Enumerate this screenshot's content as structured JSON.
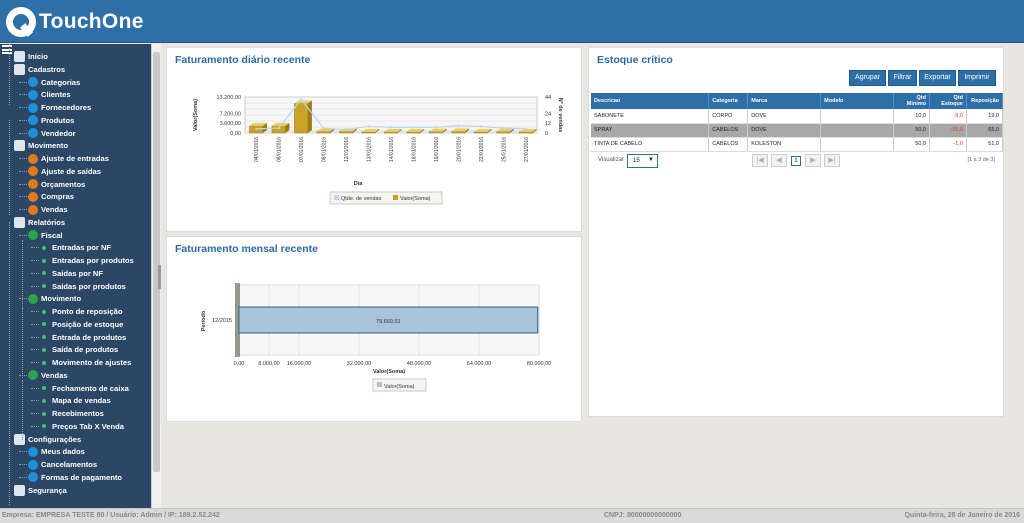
{
  "app": {
    "name": "TouchOne"
  },
  "sidebar": {
    "items": [
      {
        "label": "Início",
        "level": 0,
        "icon": "home-icon"
      },
      {
        "label": "Cadastros",
        "level": 0,
        "icon": "users-icon"
      },
      {
        "label": "Categorias",
        "level": 1,
        "icon": "blue-bullet-icon"
      },
      {
        "label": "Clientes",
        "level": 1,
        "icon": "blue-bullet-icon"
      },
      {
        "label": "Fornecedores",
        "level": 1,
        "icon": "blue-bullet-icon"
      },
      {
        "label": "Produtos",
        "level": 1,
        "icon": "blue-bullet-icon"
      },
      {
        "label": "Vendedor",
        "level": 1,
        "icon": "blue-bullet-icon"
      },
      {
        "label": "Movimento",
        "level": 0,
        "icon": "transfer-icon"
      },
      {
        "label": "Ajuste de entradas",
        "level": 1,
        "icon": "orange-bullet-icon"
      },
      {
        "label": "Ajuste de saídas",
        "level": 1,
        "icon": "orange-bullet-icon"
      },
      {
        "label": "Orçamentos",
        "level": 1,
        "icon": "orange-bullet-icon"
      },
      {
        "label": "Compras",
        "level": 1,
        "icon": "orange-bullet-icon"
      },
      {
        "label": "Vendas",
        "level": 1,
        "icon": "orange-bullet-icon"
      },
      {
        "label": "Relatórios",
        "level": 0,
        "icon": "report-chart-icon"
      },
      {
        "label": "Fiscal",
        "level": 1,
        "icon": "green-bullet-icon"
      },
      {
        "label": "Entradas por NF",
        "level": 2,
        "icon": "green-dot-icon"
      },
      {
        "label": "Entradas por produtos",
        "level": 2,
        "icon": "green-dot-icon"
      },
      {
        "label": "Saídas por NF",
        "level": 2,
        "icon": "green-dot-icon"
      },
      {
        "label": "Saídas por produtos",
        "level": 2,
        "icon": "green-dot-icon"
      },
      {
        "label": "Movimento",
        "level": 1,
        "icon": "green-bullet-icon"
      },
      {
        "label": "Ponto de reposição",
        "level": 2,
        "icon": "green-dot-icon"
      },
      {
        "label": "Posição de estoque",
        "level": 2,
        "icon": "green-dot-icon"
      },
      {
        "label": "Entrada de produtos",
        "level": 2,
        "icon": "green-dot-icon"
      },
      {
        "label": "Saída de produtos",
        "level": 2,
        "icon": "green-dot-icon"
      },
      {
        "label": "Movimento de ajustes",
        "level": 2,
        "icon": "green-dot-icon"
      },
      {
        "label": "Vendas",
        "level": 1,
        "icon": "green-bullet-icon"
      },
      {
        "label": "Fechamento de caixa",
        "level": 2,
        "icon": "green-dot-icon"
      },
      {
        "label": "Mapa de vendas",
        "level": 2,
        "icon": "green-dot-icon"
      },
      {
        "label": "Recebimentos",
        "level": 2,
        "icon": "green-dot-icon"
      },
      {
        "label": "Preços Tab X Venda",
        "level": 2,
        "icon": "green-dot-icon"
      },
      {
        "label": "Configurações",
        "level": 0,
        "icon": "tools-icon"
      },
      {
        "label": "Meus dados",
        "level": 1,
        "icon": "blue-bullet-icon"
      },
      {
        "label": "Cancelamentos",
        "level": 1,
        "icon": "blue-bullet-icon"
      },
      {
        "label": "Formas de pagamento",
        "level": 1,
        "icon": "blue-bullet-icon"
      },
      {
        "label": "Segurança",
        "level": 0,
        "icon": "security-icon"
      }
    ]
  },
  "daily": {
    "title": "Faturamento diário recente",
    "legend": [
      "Qtde. de vendas",
      "Valor(Soma)"
    ]
  },
  "monthly": {
    "title": "Faturamento mensal recente",
    "legend": [
      "Valor(Soma)"
    ]
  },
  "stock": {
    "title": "Estoque crítico",
    "buttons": [
      "Agrupar",
      "Filtrar",
      "Exportar",
      "Imprimir"
    ],
    "columns": [
      "Descricao",
      "Categoria",
      "Marca",
      "Modelo",
      "Qtd Minimo",
      "Qtd Estoque",
      "Reposição"
    ],
    "rows": [
      [
        "SABONETE",
        "CORPO",
        "DOVE",
        "",
        "10,0",
        "-9,0",
        "19,0"
      ],
      [
        "SPRAY",
        "CABELOS",
        "DOVE",
        "",
        "50,0",
        "-15,0",
        "65,0"
      ],
      [
        "TINTA DE CABELO",
        "CABELOS",
        "KOLESTON",
        "",
        "50,0",
        "-1,0",
        "51,0"
      ]
    ],
    "view_label": "Visualizar",
    "page_size": "15",
    "page": "1",
    "page_info": "[1 a 3 de 3]"
  },
  "footer": {
    "left": "Empresa: EMPRESA TESTE 80 / Usuário: Admin / IP: 189.2.52.242",
    "center": "CNPJ: 80000000000000",
    "right": "Quinta-feira, 28 de Janeiro de 2016"
  },
  "chart_data": [
    {
      "type": "bar",
      "subtype": "3d-column-with-line",
      "title": "Faturamento diário recente",
      "categories": [
        "04/01/2016",
        "06/01/2016",
        "07/01/2016",
        "08/01/2016",
        "12/01/2016",
        "13/01/2016",
        "14/01/2016",
        "18/01/2016",
        "19/01/2016",
        "20/01/2016",
        "22/01/2016",
        "25/01/2016",
        "27/01/2016"
      ],
      "series": [
        {
          "name": "Valor(Soma)",
          "axis": "left",
          "values": [
            2600,
            2600,
            10800,
            600,
            600,
            400,
            400,
            400,
            500,
            600,
            400,
            500,
            400
          ]
        },
        {
          "name": "Qtde. de vendas",
          "axis": "right",
          "values": [
            5,
            6,
            41,
            6,
            4,
            8,
            7,
            7,
            7,
            9,
            8,
            6,
            5
          ]
        }
      ],
      "xlabel": "Dia",
      "ylabel": "Valor(Soma)",
      "y2label": "Nº de vendas",
      "yticks": [
        "13.200,00",
        "7.200,00",
        "3.600,00",
        "0,00"
      ],
      "y2ticks": [
        "44",
        "24",
        "12",
        "0"
      ],
      "ylim": [
        0,
        13200
      ],
      "y2lim": [
        0,
        44
      ],
      "grid": true,
      "legend": "bottom"
    },
    {
      "type": "bar",
      "orientation": "horizontal",
      "title": "Faturamento mensal recente",
      "categories": [
        "12/2015"
      ],
      "series": [
        {
          "name": "Valor(Soma)",
          "values": [
            79669.51
          ]
        }
      ],
      "value_labels": [
        "79.669,51"
      ],
      "xlabel": "Valor(Soma)",
      "ylabel": "Período",
      "xticks": [
        "0,00",
        "8.000,00",
        "16.000,00",
        "32.000,00",
        "48.000,00",
        "64.000,00",
        "80.000,00"
      ],
      "xlim": [
        0,
        80000
      ],
      "grid": true,
      "legend": "bottom"
    }
  ]
}
